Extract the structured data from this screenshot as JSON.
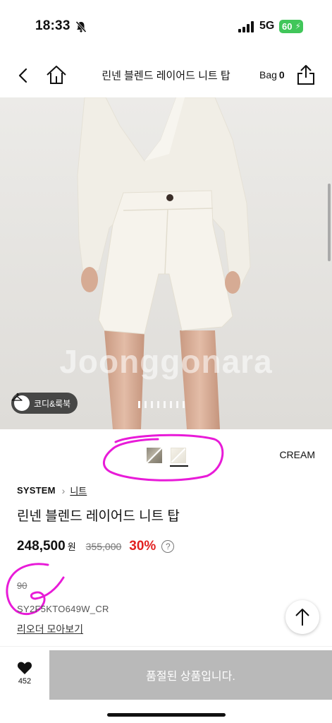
{
  "status_bar": {
    "time": "18:33",
    "network": "5G",
    "battery": "60",
    "icons": [
      "bell-off-icon",
      "signal-icon",
      "battery-icon"
    ]
  },
  "nav": {
    "title": "린넨 블렌드 레이어드 니트 탑",
    "bag_label": "Bag",
    "bag_count": "0",
    "icons": [
      "back-icon",
      "home-icon",
      "share-icon"
    ]
  },
  "hero": {
    "watermark": "Joonggonara",
    "coord_button": "코디&룩북",
    "slide_count": 8,
    "active_slide": 1
  },
  "options": {
    "color_name": "CREAM",
    "swatches": [
      "gray",
      "cream"
    ],
    "selected_swatch": "cream"
  },
  "product": {
    "brand": "SYSTEM",
    "category": "니트",
    "name": "린넨 블렌드 레이어드 니트 탑",
    "price": "248,500",
    "currency": "원",
    "original_price": "355,000",
    "discount": "30%",
    "help": "?",
    "points": "90",
    "code": "SY2F5KTO649W_CR",
    "reorder_link": "리오더 모아보기"
  },
  "bottom_bar": {
    "like_count": "452",
    "soldout_label": "품절된 상품입니다."
  },
  "colors": {
    "discount": "#e22121",
    "annotation": "#e81bd8",
    "soldout_bg": "#b9b9b9",
    "battery": "#41c65a"
  }
}
